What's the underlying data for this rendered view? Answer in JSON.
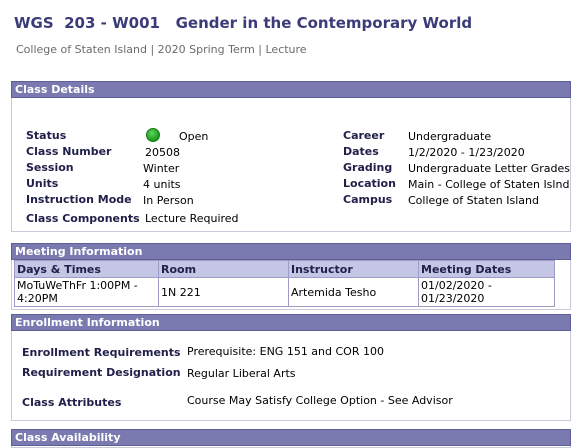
{
  "header": {
    "title": "WGS  203 - W001   Gender in the Contemporary World",
    "subtitle": "College of Staten Island | 2020 Spring Term | Lecture"
  },
  "class_details": {
    "heading": "Class Details",
    "status_label": "Status",
    "status_value": "Open",
    "status_color": "#1e9a1e",
    "class_number_label": "Class Number",
    "class_number_value": "20508",
    "session_label": "Session",
    "session_value": "Winter",
    "units_label": "Units",
    "units_value": "4 units",
    "instruction_mode_label": "Instruction Mode",
    "instruction_mode_value": "In Person",
    "class_components_label": "Class Components",
    "class_components_value": "Lecture Required",
    "career_label": "Career",
    "career_value": "Undergraduate",
    "dates_label": "Dates",
    "dates_value": "1/2/2020 - 1/23/2020",
    "grading_label": "Grading",
    "grading_value": "Undergraduate Letter Grades",
    "location_label": "Location",
    "location_value": "Main - College of Staten Islnd",
    "campus_label": "Campus",
    "campus_value": "College of Staten Island"
  },
  "meeting_information": {
    "heading": "Meeting Information",
    "columns": [
      "Days & Times",
      "Room",
      "Instructor",
      "Meeting Dates"
    ],
    "rows": [
      {
        "days_times": "MoTuWeThFr 1:00PM - 4:20PM",
        "room": "1N 221",
        "instructor": "Artemida Tesho",
        "meeting_dates": "01/02/2020 - 01/23/2020"
      }
    ]
  },
  "enrollment_information": {
    "heading": "Enrollment Information",
    "requirements_label": "Enrollment Requirements",
    "requirements_value": "Prerequisite: ENG 151 and COR 100",
    "designation_label": "Requirement Designation",
    "designation_value": "Regular Liberal Arts",
    "attributes_label": "Class Attributes",
    "attributes_value": "Course May Satisfy College Option - See Advisor"
  },
  "class_availability": {
    "heading": "Class Availability"
  }
}
